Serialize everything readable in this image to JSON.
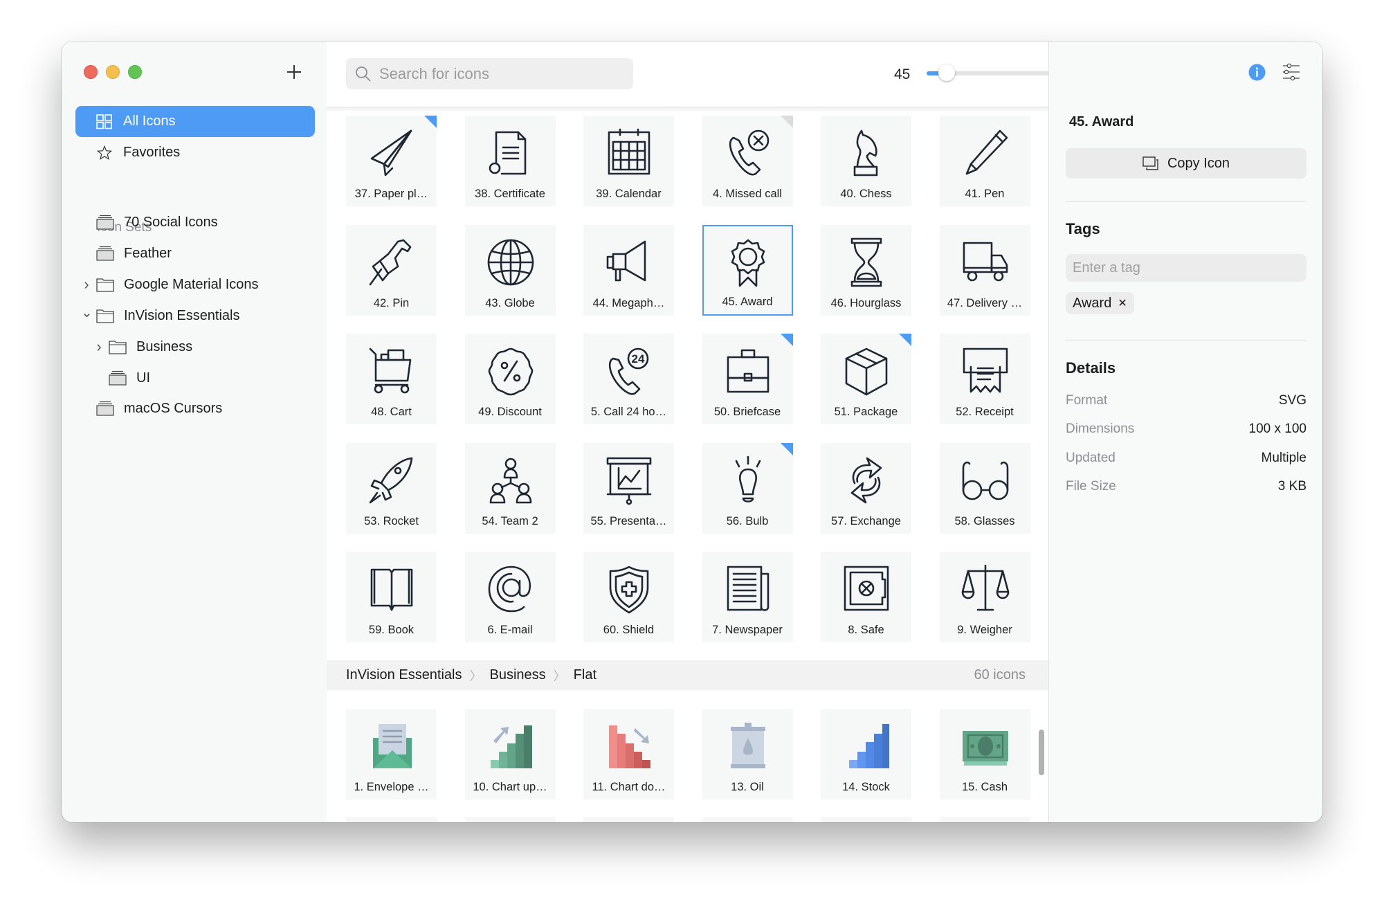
{
  "window": {
    "traffic_lights": [
      "close",
      "minimize",
      "zoom"
    ]
  },
  "sidebar": {
    "add_label": "+",
    "nav": [
      {
        "label": "All Icons",
        "icon": "grid-icon",
        "active": true
      },
      {
        "label": "Favorites",
        "icon": "star-icon",
        "active": false
      }
    ],
    "section_label": "Icon Sets",
    "tree": [
      {
        "label": "70 Social Icons",
        "icon": "icon-set-icon",
        "level": 0,
        "chevron": "none"
      },
      {
        "label": "Feather",
        "icon": "icon-set-icon",
        "level": 0,
        "chevron": "none"
      },
      {
        "label": "Google Material Icons",
        "icon": "folder-icon",
        "level": 0,
        "chevron": "collapsed"
      },
      {
        "label": "InVision Essentials",
        "icon": "folder-icon",
        "level": 0,
        "chevron": "expanded"
      },
      {
        "label": "Business",
        "icon": "folder-icon",
        "level": 1,
        "chevron": "collapsed"
      },
      {
        "label": "UI",
        "icon": "icon-set-icon",
        "level": 1,
        "chevron": "none"
      },
      {
        "label": "macOS Cursors",
        "icon": "icon-set-icon",
        "level": 0,
        "chevron": "none"
      }
    ]
  },
  "toolbar": {
    "search_placeholder": "Search for icons",
    "search_value": "",
    "icon_size": "45",
    "icon_size_fraction": 0.12
  },
  "grid": {
    "selected": "45. Award",
    "tiles": [
      {
        "label": "37. Paper pl…",
        "icon": "paper-plane-icon",
        "corner": "blue"
      },
      {
        "label": "38. Certificate",
        "icon": "certificate-icon",
        "corner": ""
      },
      {
        "label": "39. Calendar",
        "icon": "calendar-icon",
        "corner": ""
      },
      {
        "label": "4. Missed call",
        "icon": "missed-call-icon",
        "corner": "grey"
      },
      {
        "label": "40. Chess",
        "icon": "chess-icon",
        "corner": ""
      },
      {
        "label": "41. Pen",
        "icon": "pen-icon",
        "corner": ""
      },
      {
        "label": "42. Pin",
        "icon": "pin-icon",
        "corner": ""
      },
      {
        "label": "43. Globe",
        "icon": "globe-icon",
        "corner": ""
      },
      {
        "label": "44. Megaph…",
        "icon": "megaphone-icon",
        "corner": ""
      },
      {
        "label": "45. Award",
        "icon": "award-icon",
        "corner": "",
        "selected": true
      },
      {
        "label": "46. Hourglass",
        "icon": "hourglass-icon",
        "corner": ""
      },
      {
        "label": "47. Delivery …",
        "icon": "delivery-truck-icon",
        "corner": ""
      },
      {
        "label": "48. Cart",
        "icon": "cart-icon",
        "corner": ""
      },
      {
        "label": "49. Discount",
        "icon": "discount-icon",
        "corner": ""
      },
      {
        "label": "5. Call 24 ho…",
        "icon": "call-24-hours-icon",
        "corner": ""
      },
      {
        "label": "50. Briefcase",
        "icon": "briefcase-icon",
        "corner": "blue"
      },
      {
        "label": "51. Package",
        "icon": "package-icon",
        "corner": "blue"
      },
      {
        "label": "52. Receipt",
        "icon": "receipt-icon",
        "corner": ""
      },
      {
        "label": "53. Rocket",
        "icon": "rocket-icon",
        "corner": ""
      },
      {
        "label": "54. Team 2",
        "icon": "team-icon",
        "corner": ""
      },
      {
        "label": "55. Presenta…",
        "icon": "presentation-icon",
        "corner": ""
      },
      {
        "label": "56. Bulb",
        "icon": "bulb-icon",
        "corner": "blue"
      },
      {
        "label": "57. Exchange",
        "icon": "exchange-icon",
        "corner": ""
      },
      {
        "label": "58. Glasses",
        "icon": "glasses-icon",
        "corner": ""
      },
      {
        "label": "59. Book",
        "icon": "book-icon",
        "corner": ""
      },
      {
        "label": "6. E-mail",
        "icon": "email-icon",
        "corner": ""
      },
      {
        "label": "60. Shield",
        "icon": "shield-icon",
        "corner": ""
      },
      {
        "label": "7. Newspaper",
        "icon": "newspaper-icon",
        "corner": ""
      },
      {
        "label": "8. Safe",
        "icon": "safe-icon",
        "corner": ""
      },
      {
        "label": "9. Weigher",
        "icon": "weigher-icon",
        "corner": ""
      }
    ]
  },
  "section2": {
    "breadcrumb": [
      "InVision Essentials",
      "Business",
      "Flat"
    ],
    "count": "60 icons",
    "tiles": [
      {
        "label": "1. Envelope …",
        "icon": "envelope-flat-icon"
      },
      {
        "label": "10. Chart up…",
        "icon": "chart-up-flat-icon"
      },
      {
        "label": "11. Chart do…",
        "icon": "chart-down-flat-icon"
      },
      {
        "label": "13. Oil",
        "icon": "oil-flat-icon"
      },
      {
        "label": "14. Stock",
        "icon": "stock-flat-icon"
      },
      {
        "label": "15. Cash",
        "icon": "cash-flat-icon"
      }
    ]
  },
  "inspector": {
    "title": "45. Award",
    "copy_label": "Copy Icon",
    "tags_title": "Tags",
    "tag_placeholder": "Enter a tag",
    "tags": [
      "Award"
    ],
    "details_title": "Details",
    "details": [
      {
        "key": "Format",
        "value": "SVG"
      },
      {
        "key": "Dimensions",
        "value": "100 x 100"
      },
      {
        "key": "Updated",
        "value": "Multiple"
      },
      {
        "key": "File Size",
        "value": "3 KB"
      }
    ]
  },
  "colors": {
    "accent": "#4d9bf5",
    "stroke": "#1f2733"
  }
}
